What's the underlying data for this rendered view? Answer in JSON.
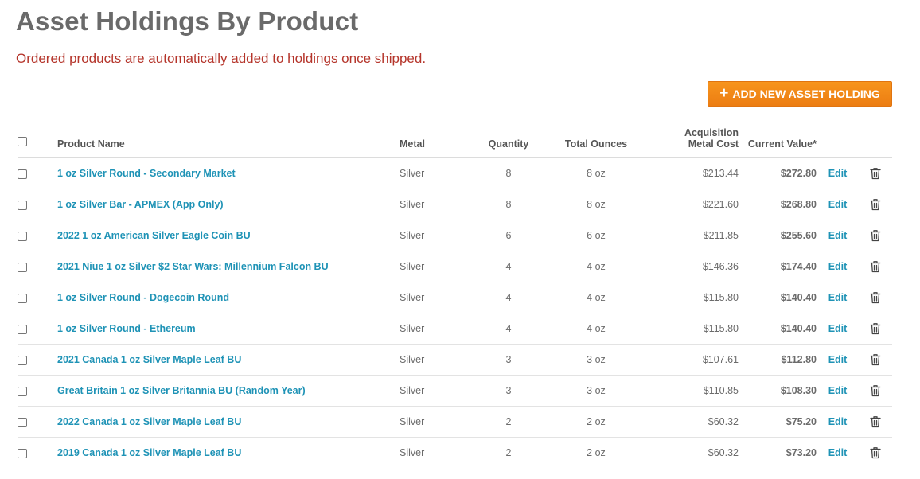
{
  "header": {
    "title": "Asset Holdings By Product",
    "notice": "Ordered products are automatically added to holdings once shipped."
  },
  "actions": {
    "add_label": "ADD NEW ASSET HOLDING",
    "add_icon": "plus-icon"
  },
  "colors": {
    "title": "#6a6a6a",
    "notice": "#b5352b",
    "accent": "#f0861a",
    "link": "#1f93b6"
  },
  "table": {
    "columns": {
      "product_name": "Product Name",
      "metal": "Metal",
      "quantity": "Quantity",
      "total_ounces": "Total Ounces",
      "acquisition_line1": "Acquisition",
      "acquisition_line2": "Metal Cost",
      "current_value": "Current Value*"
    },
    "edit_label": "Edit",
    "delete_icon": "trash-icon",
    "rows": [
      {
        "name": "1 oz Silver Round - Secondary Market",
        "metal": "Silver",
        "quantity": "8",
        "ounces": "8 oz",
        "cost": "$213.44",
        "value": "$272.80"
      },
      {
        "name": "1 oz Silver Bar - APMEX (App Only)",
        "metal": "Silver",
        "quantity": "8",
        "ounces": "8 oz",
        "cost": "$221.60",
        "value": "$268.80"
      },
      {
        "name": "2022 1 oz American Silver Eagle Coin BU",
        "metal": "Silver",
        "quantity": "6",
        "ounces": "6 oz",
        "cost": "$211.85",
        "value": "$255.60"
      },
      {
        "name": "2021 Niue 1 oz Silver $2 Star Wars: Millennium Falcon BU",
        "metal": "Silver",
        "quantity": "4",
        "ounces": "4 oz",
        "cost": "$146.36",
        "value": "$174.40"
      },
      {
        "name": "1 oz Silver Round - Dogecoin Round",
        "metal": "Silver",
        "quantity": "4",
        "ounces": "4 oz",
        "cost": "$115.80",
        "value": "$140.40"
      },
      {
        "name": "1 oz Silver Round - Ethereum",
        "metal": "Silver",
        "quantity": "4",
        "ounces": "4 oz",
        "cost": "$115.80",
        "value": "$140.40"
      },
      {
        "name": "2021 Canada 1 oz Silver Maple Leaf BU",
        "metal": "Silver",
        "quantity": "3",
        "ounces": "3 oz",
        "cost": "$107.61",
        "value": "$112.80"
      },
      {
        "name": "Great Britain 1 oz Silver Britannia BU (Random Year)",
        "metal": "Silver",
        "quantity": "3",
        "ounces": "3 oz",
        "cost": "$110.85",
        "value": "$108.30"
      },
      {
        "name": "2022 Canada 1 oz Silver Maple Leaf BU",
        "metal": "Silver",
        "quantity": "2",
        "ounces": "2 oz",
        "cost": "$60.32",
        "value": "$75.20"
      },
      {
        "name": "2019 Canada 1 oz Silver Maple Leaf BU",
        "metal": "Silver",
        "quantity": "2",
        "ounces": "2 oz",
        "cost": "$60.32",
        "value": "$73.20"
      }
    ]
  }
}
